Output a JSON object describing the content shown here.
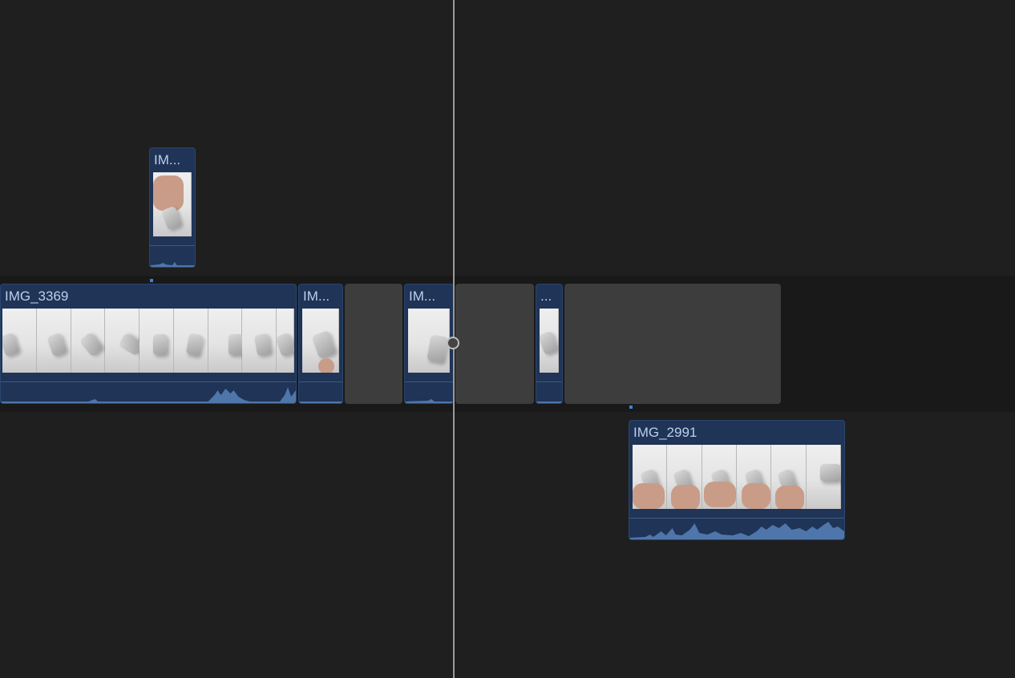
{
  "timeline": {
    "primary_clips": [
      {
        "id": "img3369",
        "label": "IMG_3369"
      },
      {
        "id": "im2",
        "label": "IM..."
      },
      {
        "id": "im3",
        "label": "IM..."
      },
      {
        "id": "im4",
        "label": "..."
      }
    ],
    "connected_clips": [
      {
        "id": "top",
        "label": "IM..."
      },
      {
        "id": "img2991",
        "label": "IMG_2991"
      }
    ]
  },
  "colors": {
    "background": "#1f1f1f",
    "primary_lane": "#191919",
    "clip_fill": "#1f3456",
    "clip_label": "#bcd0ec",
    "gap_fill": "#3d3d3d",
    "playhead": "#9a9a9a"
  }
}
